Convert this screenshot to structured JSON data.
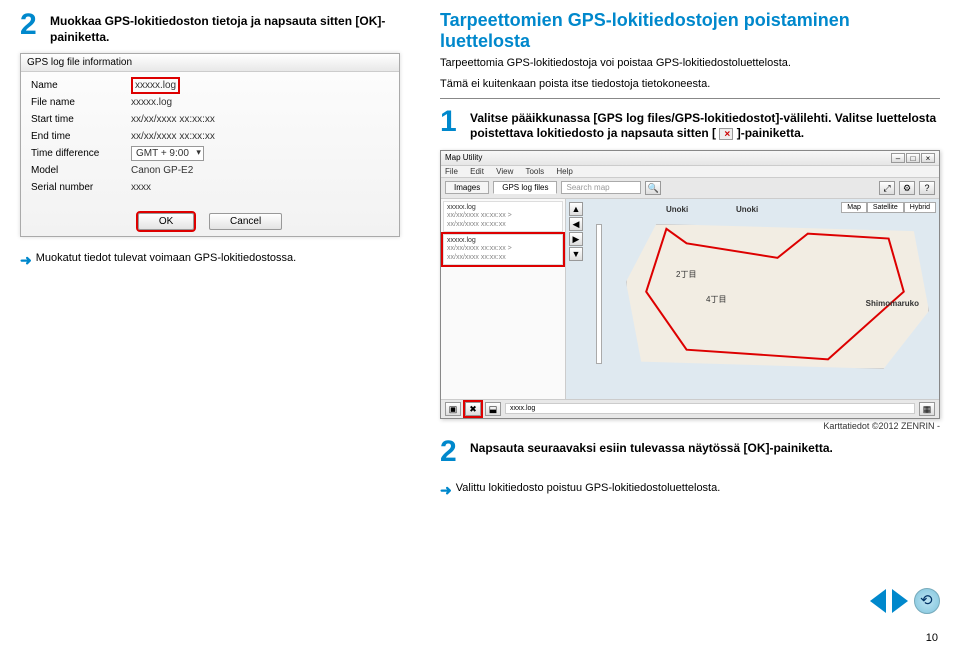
{
  "left": {
    "step2_label": "2",
    "step2_text": "Muokkaa GPS-lokitiedoston tietoja ja napsauta sitten [OK]-painiketta.",
    "dialog": {
      "title": "GPS log file information",
      "rows": {
        "name_label": "Name",
        "name_value": "xxxxx.log",
        "file_label": "File name",
        "file_value": "xxxxx.log",
        "start_label": "Start time",
        "start_value": "xx/xx/xxxx xx:xx:xx",
        "end_label": "End time",
        "end_value": "xx/xx/xxxx xx:xx:xx",
        "tz_label": "Time difference",
        "tz_value": "GMT + 9:00",
        "model_label": "Model",
        "model_value": "Canon GP-E2",
        "serial_label": "Serial number",
        "serial_value": "xxxx"
      },
      "ok": "OK",
      "cancel": "Cancel"
    },
    "result": "Muokatut tiedot tulevat voimaan GPS-lokitiedostossa."
  },
  "right": {
    "section_title": "Tarpeettomien GPS-lokitiedostojen poistaminen luettelosta",
    "intro1": "Tarpeettomia GPS-lokitiedostoja voi poistaa GPS-lokitiedostoluettelosta.",
    "intro2": "Tämä ei kuitenkaan poista itse tiedostoja tietokoneesta.",
    "step1_num": "1",
    "step1_text_a": "Valitse pääikkunassa [GPS log files/GPS-lokitiedostot]-välilehti. Valitse luettelosta poistettava lokitiedosto ja napsauta sitten [",
    "step1_text_b": "]-painiketta.",
    "maputil": {
      "title": "Map Utility",
      "menu": {
        "file": "File",
        "edit": "Edit",
        "view": "View",
        "tools": "Tools",
        "help": "Help"
      },
      "tabs": {
        "images": "Images",
        "gps": "GPS log files"
      },
      "search_ph": "Search map",
      "logs": [
        {
          "name": "xxxxx.log",
          "l1": "xx/xx/xxxx xx:xx:xx >",
          "l2": "xx/xx/xxxx xx:xx:xx"
        },
        {
          "name": "xxxxx.log",
          "l1": "xx/xx/xxxx xx:xx:xx >",
          "l2": "xx/xx/xxxx xx:xx:xx"
        }
      ],
      "maptabs": {
        "map": "Map",
        "sat": "Satellite",
        "hyb": "Hybrid"
      },
      "place1": "Unoki",
      "place2": "Unoki",
      "place3": "Shimomaruko",
      "block1": "2丁目",
      "block2": "4丁目",
      "status_name": "xxxx.log",
      "credit_full": "Karttatiedot ©2012 ZENRIN -"
    },
    "step2_num": "2",
    "step2_text": "Napsauta seuraavaksi esiin tulevassa näytössä [OK]-painiketta.",
    "result2": "Valittu lokitiedosto poistuu GPS-lokitiedostoluettelosta."
  },
  "page_num": "10"
}
